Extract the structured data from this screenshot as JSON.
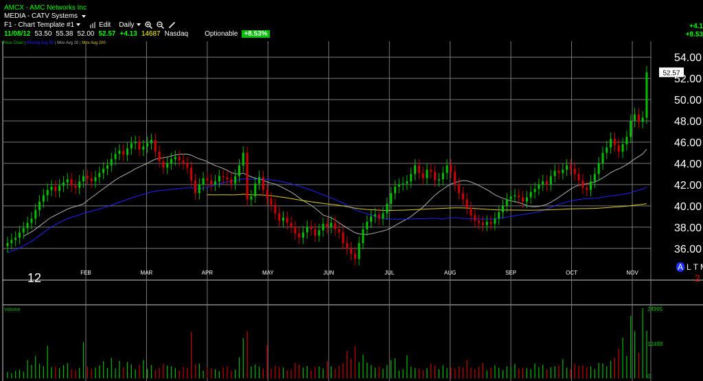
{
  "header": {
    "ticker_line": "AMCX - AMC Networks Inc",
    "sector_line": "MEDIA - CATV Systems",
    "template_label": "F1 - Chart Template #1",
    "edit_label": "Edit",
    "period_label": "Daily",
    "quote": {
      "date": "11/08/12",
      "open": "53.50",
      "high": "55.38",
      "low": "52.00",
      "close": "52.57",
      "change": "+4.13",
      "volume": "14687",
      "exchange": "Nasdaq",
      "optionable": "Optionable",
      "pct_change": "+8.53%"
    },
    "right_change_abs": "+4.1",
    "right_change_pct": "+8.53"
  },
  "legend": {
    "price_label": "Price Chart",
    "ma50_label": "Moving Avg 50",
    "ma20_label": "Mov Avg 20",
    "ma200_label": "Mov Avg 200"
  },
  "colors": {
    "up": "#00c000",
    "down": "#d00000",
    "ma20": "#b0b0b0",
    "ma50": "#2020ff",
    "ma200": "#e0d020",
    "grid": "#7a7a7a",
    "accent": "#00ff00"
  },
  "footer": {
    "year_label": "12",
    "altm_a": "A",
    "altm_l": "L",
    "altm_t": "T",
    "altm_m": "M",
    "red_digit": "2"
  },
  "chart_data": [
    {
      "type": "candlestick",
      "title": "",
      "x_labels": [
        "FEB",
        "MAR",
        "APR",
        "MAY",
        "JUN",
        "JUL",
        "AUG",
        "SEP",
        "OCT",
        "NOV"
      ],
      "y_ticks": [
        "54.00",
        "52.00",
        "50.00",
        "48.00",
        "46.00",
        "44.00",
        "42.00",
        "40.00",
        "38.00",
        "36.00"
      ],
      "ylim": [
        34.5,
        55.5
      ],
      "last_price_label": "52.57",
      "close_series": [
        36.5,
        36.8,
        37.0,
        37.5,
        37.9,
        38.4,
        38.8,
        39.6,
        40.4,
        41.0,
        41.5,
        41.8,
        41.4,
        41.9,
        42.2,
        42.5,
        41.9,
        41.7,
        42.3,
        42.8,
        42.6,
        42.3,
        42.7,
        43.1,
        43.5,
        43.8,
        44.4,
        44.9,
        45.2,
        44.8,
        45.4,
        45.9,
        46.0,
        45.3,
        45.6,
        45.9,
        46.2,
        45.1,
        44.2,
        43.6,
        44.0,
        44.4,
        44.6,
        44.3,
        44.0,
        43.6,
        42.4,
        41.2,
        42.0,
        42.6,
        42.4,
        42.0,
        42.3,
        42.8,
        42.7,
        42.5,
        42.1,
        42.8,
        43.8,
        45.0,
        40.6,
        40.9,
        42.1,
        42.7,
        41.5,
        40.7,
        40.1,
        39.3,
        38.6,
        38.9,
        38.4,
        38.0,
        37.4,
        37.0,
        37.5,
        38.0,
        37.8,
        37.2,
        37.7,
        38.3,
        38.0,
        38.4,
        37.8,
        37.5,
        36.5,
        36.0,
        35.5,
        35.0,
        36.5,
        37.8,
        38.5,
        39.0,
        39.2,
        38.8,
        39.3,
        40.2,
        41.2,
        41.8,
        42.0,
        42.1,
        42.3,
        43.0,
        43.8,
        43.1,
        42.6,
        43.4,
        43.2,
        42.4,
        42.5,
        43.1,
        43.8,
        43.2,
        42.0,
        41.2,
        40.6,
        39.8,
        39.1,
        38.6,
        38.4,
        38.2,
        38.5,
        38.3,
        38.8,
        39.4,
        40.0,
        40.6,
        40.9,
        41.0,
        40.8,
        40.4,
        40.8,
        41.3,
        41.6,
        42.0,
        42.3,
        42.0,
        42.8,
        43.3,
        43.1,
        43.4,
        43.8,
        43.5,
        43.0,
        42.4,
        41.7,
        41.5,
        42.3,
        43.0,
        44.0,
        45.0,
        45.5,
        46.3,
        45.7,
        45.1,
        45.8,
        46.5,
        48.0,
        48.6,
        47.9,
        48.3,
        52.57
      ],
      "ma20_note": "Mov Avg 20",
      "ma50_note": "Moving Avg 50",
      "ma200_note": "Mov Avg 200"
    },
    {
      "type": "bar",
      "title": "Volume",
      "y_ticks": [
        "24995",
        "12498",
        "0"
      ],
      "ylim": [
        0,
        24995
      ],
      "values": [
        2200,
        1800,
        2600,
        3100,
        2400,
        6500,
        4800,
        7900,
        5200,
        4300,
        11600,
        3900,
        4100,
        3600,
        4700,
        5400,
        3200,
        2900,
        3700,
        12800,
        4100,
        3400,
        3800,
        4600,
        6100,
        3700,
        7300,
        3500,
        6200,
        3900,
        5800,
        4900,
        3100,
        4800,
        6500,
        3300,
        4700,
        2900,
        3800,
        5100,
        4500,
        4200,
        3600,
        2700,
        4000,
        3800,
        16500,
        4900,
        5200,
        2700,
        3900,
        3500,
        3200,
        2500,
        3900,
        4200,
        2600,
        3100,
        7500,
        14300,
        16800,
        4200,
        4900,
        4100,
        3500,
        11800,
        3400,
        4400,
        4000,
        3800,
        2700,
        3100,
        5500,
        4900,
        3800,
        4400,
        2800,
        3900,
        4200,
        3500,
        6200,
        4200,
        3400,
        4500,
        5400,
        9800,
        7000,
        11500,
        5800,
        8400,
        5600,
        4600,
        3800,
        4200,
        3400,
        4700,
        6500,
        7100,
        2700,
        3300,
        8200,
        4100,
        3600,
        3400,
        2900,
        3600,
        5200,
        4500,
        3200,
        4700,
        3600,
        3800,
        3400,
        4200,
        3900,
        6500,
        3800,
        3200,
        4100,
        5500,
        2800,
        3800,
        4600,
        3700,
        2900,
        4200,
        3900,
        5100,
        3500,
        3800,
        3600,
        3200,
        5300,
        3900,
        4800,
        3200,
        3900,
        4300,
        4600,
        6800,
        3800,
        3200,
        5100,
        4400,
        4600,
        3900,
        4200,
        3300,
        5500,
        5300,
        4200,
        6200,
        7300,
        10500,
        14500,
        8000,
        22300,
        16800,
        9100,
        24995,
        16900,
        14687
      ],
      "xlabel": "",
      "ylabel": ""
    }
  ]
}
